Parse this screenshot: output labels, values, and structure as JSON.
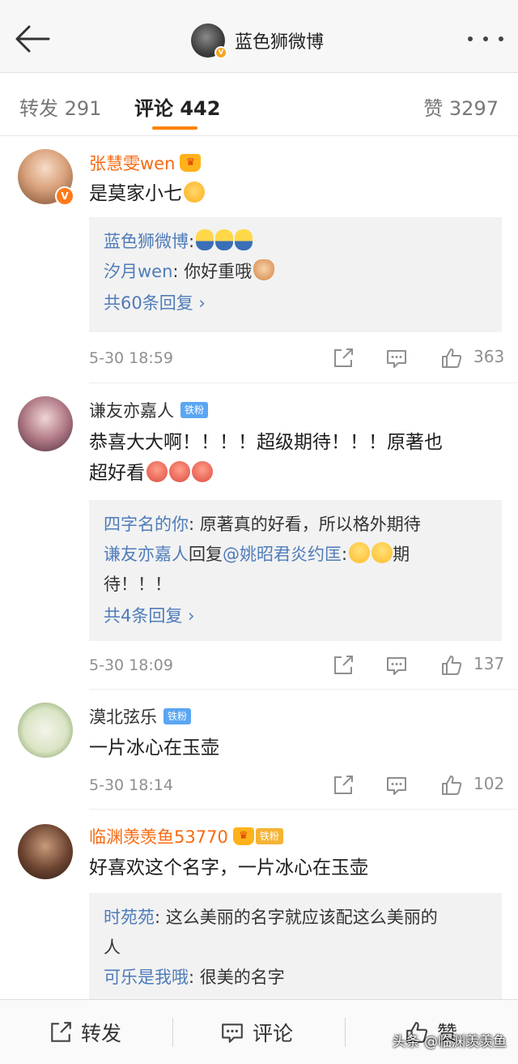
{
  "header": {
    "title": "蓝色狮微博"
  },
  "tabs": {
    "repost": "转发 291",
    "comment": "评论 442",
    "like": "赞 3297"
  },
  "comments": [
    {
      "name": "张慧雯wen",
      "text": "是莫家小七",
      "replies": [
        {
          "name": "蓝色狮微博",
          "text": ":"
        },
        {
          "name": "汐月wen",
          "text": ": 你好重哦"
        }
      ],
      "more": "共60条回复 ›",
      "time": "5-30 18:59",
      "likes": "363"
    },
    {
      "name": "谦友亦嘉人",
      "badge": "铁粉",
      "text_line1": "恭喜大大啊！！！！超级期待！！！原著也",
      "text_line2": "超好看",
      "replies": [
        {
          "name": "四字名的你",
          "text": ": 原著真的好看，所以格外期待"
        },
        {
          "name": "谦友亦嘉人",
          "text": "回复",
          "mention": "@姚昭君炎约匡",
          "tail": ":",
          "tail2": "期",
          "cont": "待！！！"
        }
      ],
      "more": "共4条回复 ›",
      "time": "5-30 18:09",
      "likes": "137"
    },
    {
      "name": "漠北弦乐",
      "badge": "铁粉",
      "text": "一片冰心在玉壶",
      "time": "5-30 18:14",
      "likes": "102"
    },
    {
      "name": "临渊羡羡鱼53770",
      "badge": "铁粉",
      "text": "好喜欢这个名字，一片冰心在玉壶",
      "replies": [
        {
          "name": "时苑苑",
          "text": ": 这么美丽的名字就应该配这么美丽的",
          "cont": "人"
        },
        {
          "name": "可乐是我哦",
          "text": ": 很美的名字"
        }
      ]
    }
  ],
  "bottom": {
    "repost": "转发",
    "comment": "评论",
    "like": "赞"
  },
  "watermark": "头条 @临渊羡羡鱼",
  "colors": {
    "accent": "#ff8200",
    "vip_name": "#f86a10",
    "link": "#4f7cb9",
    "fan_badge": "#5aa6f2"
  }
}
